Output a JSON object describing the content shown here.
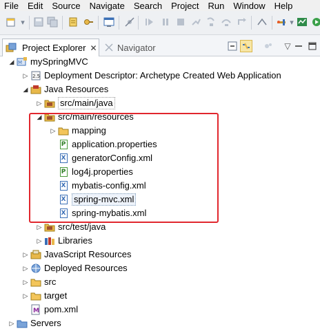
{
  "menu": [
    "File",
    "Edit",
    "Source",
    "Navigate",
    "Search",
    "Project",
    "Run",
    "Window",
    "Help"
  ],
  "tabs": {
    "active": "Project Explorer",
    "active_close": "✕",
    "inactive": "Navigator"
  },
  "tree": {
    "project": "mySpringMVC",
    "deployment": "Deployment Descriptor: Archetype Created Web Application",
    "java_resources": "Java Resources",
    "src_main_java": "src/main/java",
    "src_main_resources": "src/main/resources",
    "mapping": "mapping",
    "application_properties": "application.properties",
    "generator_config": "generatorConfig.xml",
    "log4j": "log4j.properties",
    "mybatis_config": "mybatis-config.xml",
    "spring_mvc": "spring-mvc.xml",
    "spring_mybatis": "spring-mybatis.xml",
    "src_test_java": "src/test/java",
    "libraries": "Libraries",
    "js_resources": "JavaScript Resources",
    "deployed_resources": "Deployed Resources",
    "src": "src",
    "target": "target",
    "pom": "pom.xml",
    "servers": "Servers"
  },
  "colors": {
    "highlight": "#e1262d",
    "folder": "#e8b84a",
    "xml": "#3b6fb6",
    "properties": "#2f7d25"
  }
}
